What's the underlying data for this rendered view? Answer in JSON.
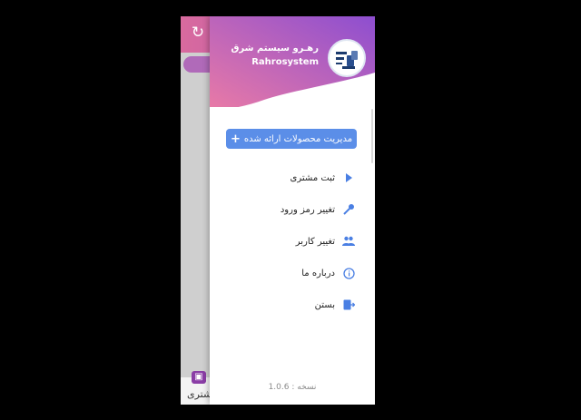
{
  "background_app": {
    "refresh_icon": "refresh-icon",
    "bottom_tab": {
      "label": "مشتری",
      "icon": "image-icon"
    }
  },
  "drawer": {
    "brand_name_fa": "رهـرو سیستم شرق",
    "brand_name_en": "Rahrosystem",
    "logo": "company-logo",
    "manage_button": "مدیریت محصولات ارائه شده",
    "manage_button_icon": "+",
    "menu": [
      {
        "label": "ثبت مشتری",
        "icon": "triangle-right-icon"
      },
      {
        "label": "تغییر رمز ورود",
        "icon": "key-icon"
      },
      {
        "label": "تغییر کاربر",
        "icon": "users-icon"
      },
      {
        "label": "درباره ما",
        "icon": "info-icon"
      },
      {
        "label": "بستن",
        "icon": "exit-icon"
      }
    ],
    "version": "نسخه : 1.0.6"
  },
  "colors": {
    "header_gradient_start": "#e97aa6",
    "header_gradient_end": "#8d4ed0",
    "accent": "#5b8ee8",
    "icon_blue": "#4a7fe3"
  }
}
